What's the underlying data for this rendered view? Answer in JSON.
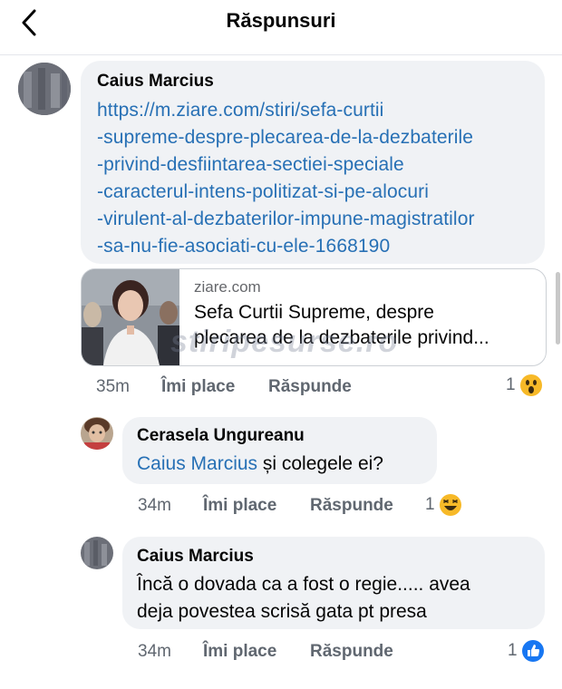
{
  "header": {
    "title": "Răspunsuri"
  },
  "comments": [
    {
      "author": "Caius Marcius",
      "link_lines": [
        "https://m.ziare.com/stiri/sefa-curtii",
        "-supreme-despre-plecarea-de-la-dezbaterile",
        "-privind-desfiintarea-sectiei-speciale",
        "-caracterul-intens-politizat-si-pe-alocuri",
        "-virulent-al-dezbaterilor-impune-magistratilor",
        "-sa-nu-fie-asociati-cu-ele-1668190"
      ],
      "preview": {
        "domain": "ziare.com",
        "title_lines": [
          "Sefa Curtii Supreme, despre",
          "plecarea de la dezbaterile privind..."
        ]
      },
      "time": "35m",
      "like_label": "Îmi place",
      "reply_label": "Răspunde",
      "reaction_count": "1",
      "reaction_icon": "wow-icon"
    },
    {
      "author": "Cerasela Ungureanu",
      "mention": "Caius Marcius",
      "text": " și colegele ei?",
      "time": "34m",
      "like_label": "Îmi place",
      "reply_label": "Răspunde",
      "reaction_count": "1",
      "reaction_icon": "haha-icon"
    },
    {
      "author": "Caius Marcius",
      "text_lines": [
        "Încă o dovada ca a fost o regie..... avea",
        "deja povestea scrisă gata pt presa"
      ],
      "time": "34m",
      "like_label": "Îmi place",
      "reply_label": "Răspunde",
      "reaction_count": "1",
      "reaction_icon": "like-icon"
    }
  ],
  "watermark": "stiripesurse.ro",
  "colors": {
    "link": "#2770b5",
    "bubble": "#f0f2f5",
    "muted": "#606770",
    "like_blue": "#1877f2",
    "emoji_yellow": "#f7b928"
  }
}
